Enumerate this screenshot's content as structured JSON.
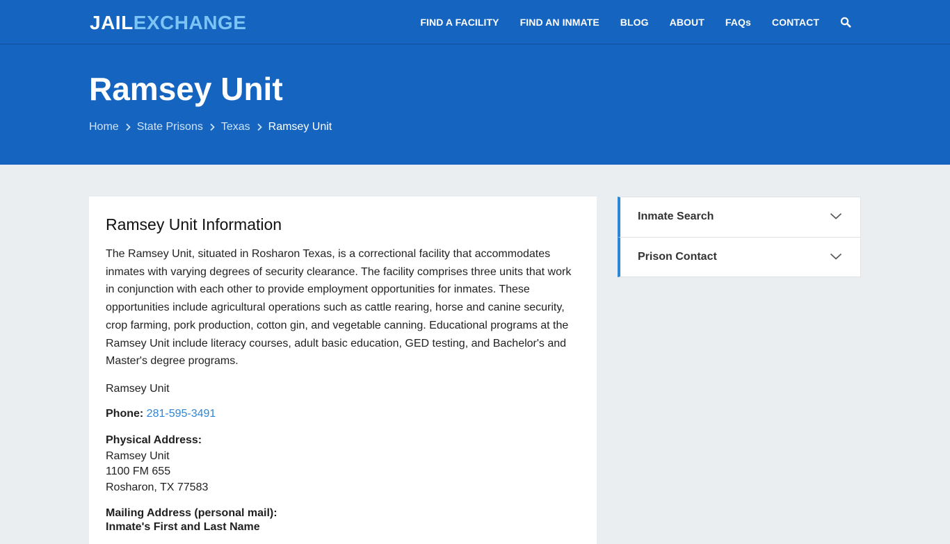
{
  "header": {
    "logo_part1": "JAIL",
    "logo_part2": "EXCHANGE",
    "nav": [
      "FIND A FACILITY",
      "FIND AN INMATE",
      "BLOG",
      "ABOUT",
      "FAQs",
      "CONTACT"
    ],
    "search_icon": "search-icon"
  },
  "hero": {
    "title": "Ramsey Unit",
    "breadcrumbs": [
      "Home",
      "State Prisons",
      "Texas",
      "Ramsey Unit"
    ]
  },
  "main": {
    "heading": "Ramsey Unit Information",
    "description": "The Ramsey Unit, situated in Rosharon Texas, is a correctional facility that accommodates inmates with varying degrees of security clearance. The facility comprises three units that work in conjunction with each other to provide employment opportunities for inmates. These opportunities include agricultural operations such as cattle rearing, horse and canine security, crop farming, pork production, cotton gin, and vegetable canning. Educational programs at the Ramsey Unit include literacy courses, adult basic education, GED testing, and Bachelor's and Master's degree programs.",
    "facility_name": "Ramsey Unit",
    "phone_label": "Phone:",
    "phone": "281-595-3491",
    "physical_label": "Physical Address:",
    "physical_lines": [
      "Ramsey Unit",
      "1100 FM 655",
      "Rosharon, TX 77583"
    ],
    "mailing_label": "Mailing Address (personal mail):",
    "mailing_line1": "Inmate's First and Last Name"
  },
  "sidebar": {
    "items": [
      "Inmate Search",
      "Prison Contact"
    ]
  },
  "colors": {
    "brand_blue": "#1565c0",
    "accent_blue": "#2f86d6",
    "logo_light": "#7cc4f5",
    "page_bg": "#eaeef1"
  }
}
